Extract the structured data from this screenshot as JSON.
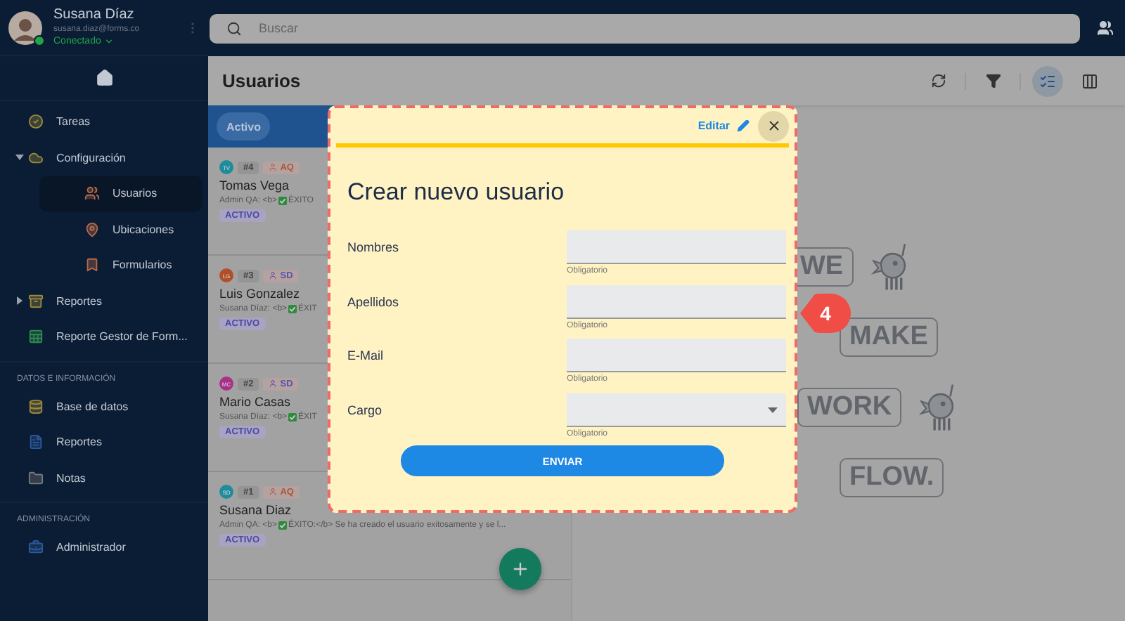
{
  "profile": {
    "name": "Susana Díaz",
    "email": "susana.diaz@forms.co",
    "status": "Conectado",
    "online": true
  },
  "search": {
    "placeholder": "Buscar"
  },
  "sidebar": {
    "items": [
      {
        "kind": "item",
        "label": "Tareas",
        "selected": false
      },
      {
        "kind": "item",
        "label": "Configuración",
        "selected": false,
        "expanded": true,
        "children": [
          {
            "kind": "item",
            "label": "Usuarios",
            "selected": true
          },
          {
            "kind": "item",
            "label": "Ubicaciones",
            "selected": false
          },
          {
            "kind": "item",
            "label": "Formularios",
            "selected": false
          }
        ]
      },
      {
        "kind": "item",
        "label": "Reportes",
        "selected": false,
        "expanded": false
      },
      {
        "kind": "item",
        "label": "Reporte Gestor de Form...",
        "selected": false
      },
      {
        "kind": "section",
        "label": "DATOS E INFORMACIÓN"
      },
      {
        "kind": "item",
        "label": "Base de datos",
        "selected": false
      },
      {
        "kind": "item",
        "label": "Reportes",
        "selected": false
      },
      {
        "kind": "item",
        "label": "Notas",
        "selected": false
      },
      {
        "kind": "section",
        "label": "ADMINISTRACIÓN"
      },
      {
        "kind": "item",
        "label": "Administrador",
        "selected": false
      }
    ]
  },
  "page": {
    "title": "Usuarios",
    "view_buttons": [
      {
        "kind": "list",
        "selected": true
      },
      {
        "kind": "board",
        "selected": false
      }
    ]
  },
  "tabs": [
    {
      "label": "Activo",
      "selected": true
    }
  ],
  "cards": [
    {
      "initials": "TV",
      "color": "#1f8c9c",
      "number": "#4",
      "owner": {
        "label": "AQ",
        "color": "#a8593f"
      },
      "name": "Tomas Vega",
      "message_before": "Admin QA: <b>",
      "message_after": "ÉXITO",
      "status": "ACTIVO"
    },
    {
      "initials": "LG",
      "color": "#b0502a",
      "number": "#3",
      "owner": {
        "label": "SD",
        "color": "#5454a8"
      },
      "name": "Luis Gonzalez",
      "message_before": "Susana Díaz: <b>",
      "message_after": "ÉXIT",
      "status": "ACTIVO"
    },
    {
      "initials": "MC",
      "color": "#a8308a",
      "number": "#2",
      "owner": {
        "label": "SD",
        "color": "#5454a8"
      },
      "name": "Mario Casas",
      "message_before": "Susana Díaz: <b>",
      "message_after": "ÉXIT",
      "status": "ACTIVO"
    },
    {
      "initials": "SD",
      "color": "#1f8c9c",
      "number": "#1",
      "owner": {
        "label": "AQ",
        "color": "#a8593f"
      },
      "name": "Susana Diaz",
      "message_before": "Admin QA: <b>",
      "message_after": "ÉXITO:</b> Se ha creado el usuario exitosamente y se l...",
      "status": "ACTIVO"
    }
  ],
  "illustration": {
    "bubbles": [
      "WE",
      "MAKE",
      "WORK",
      "FLOW."
    ]
  },
  "modal": {
    "edit_label": "Editar",
    "title": "Crear nuevo usuario",
    "fields": [
      {
        "kind": "text",
        "label": "Nombres",
        "helper": "Obligatorio"
      },
      {
        "kind": "text",
        "label": "Apellidos",
        "helper": "Obligatorio"
      },
      {
        "kind": "text",
        "label": "E-Mail",
        "helper": "Obligatorio"
      },
      {
        "kind": "select",
        "label": "Cargo",
        "helper": "Obligatorio"
      }
    ],
    "submit": "ENVIAR"
  },
  "callout": "4"
}
